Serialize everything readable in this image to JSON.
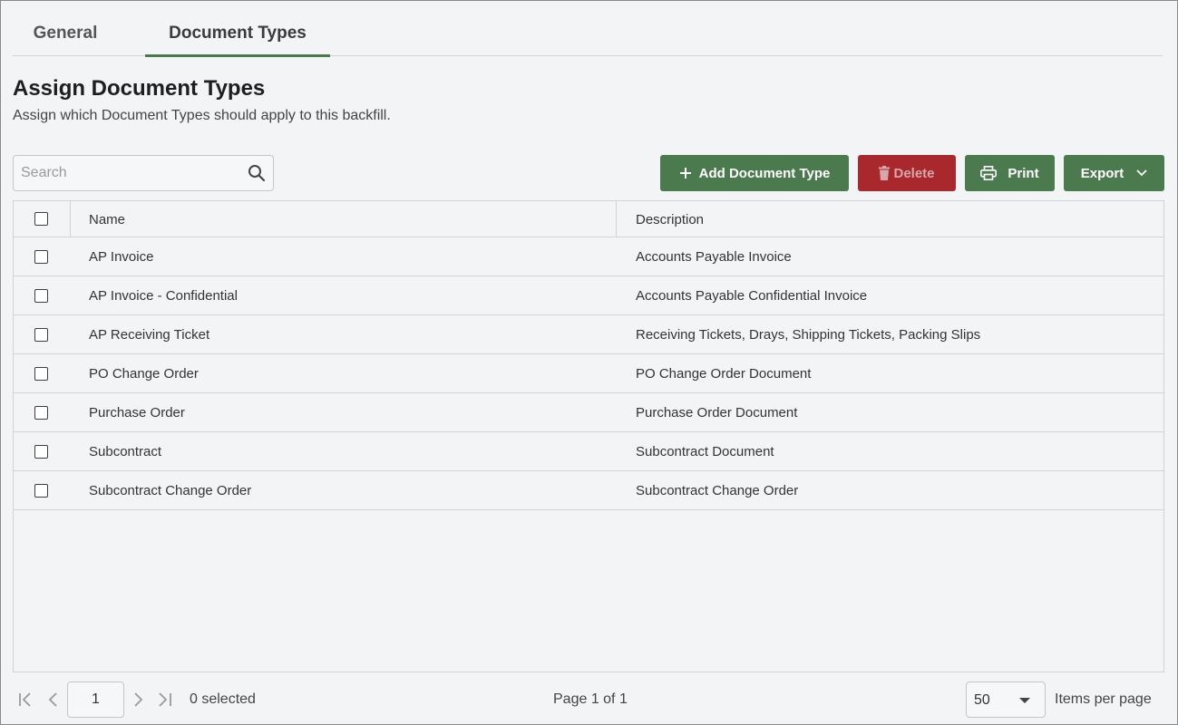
{
  "tabs": [
    {
      "label": "General",
      "active": false
    },
    {
      "label": "Document Types",
      "active": true
    }
  ],
  "header": {
    "title": "Assign Document Types",
    "subtitle": "Assign which Document Types should apply to this backfill."
  },
  "search": {
    "placeholder": "Search",
    "value": ""
  },
  "toolbar": {
    "add_label": "Add Document Type",
    "delete_label": "Delete",
    "print_label": "Print",
    "export_label": "Export"
  },
  "table": {
    "columns": [
      "Name",
      "Description"
    ],
    "rows": [
      {
        "name": "AP Invoice",
        "description": "Accounts Payable Invoice"
      },
      {
        "name": "AP Invoice - Confidential",
        "description": "Accounts Payable Confidential Invoice"
      },
      {
        "name": "AP Receiving Ticket",
        "description": "Receiving Tickets, Drays, Shipping Tickets, Packing Slips"
      },
      {
        "name": "PO Change Order",
        "description": "PO Change Order Document"
      },
      {
        "name": "Purchase Order",
        "description": "Purchase Order Document"
      },
      {
        "name": "Subcontract",
        "description": "Subcontract Document"
      },
      {
        "name": "Subcontract Change Order",
        "description": "Subcontract Change Order"
      }
    ]
  },
  "pager": {
    "current_page": "1",
    "selected_text": "0 selected",
    "page_info": "Page 1 of 1",
    "items_per_page": "50",
    "items_per_page_label": "Items per page"
  },
  "colors": {
    "accent_green": "#4b7a4f",
    "delete_red": "#a8282d",
    "background": "#f3f4f6"
  }
}
